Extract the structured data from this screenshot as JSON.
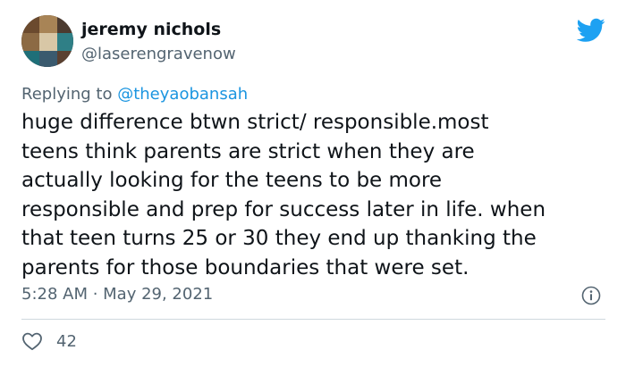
{
  "author": {
    "display_name": "jeremy nichols",
    "handle": "@laserengravenow"
  },
  "reply": {
    "prefix": "Replying to",
    "mention": "@theyaobansah"
  },
  "body_lines": [
    "huge difference btwn strict/ responsible.most",
    "teens think parents are strict when they are",
    "actually looking for the teens to be more",
    "responsible and prep for success later in life. when",
    "that teen turns 25 or 30 they end up thanking the",
    "parents for those boundaries that were set."
  ],
  "timestamp": "5:28 AM · May 29, 2021",
  "likes": "42",
  "icons": {
    "brand": "twitter-bird-icon",
    "info": "info-icon",
    "like": "heart-icon"
  },
  "colors": {
    "brand_blue": "#1da1f2",
    "mention_blue": "#1b95e0",
    "secondary_text": "#536471",
    "divider": "#cfd9de"
  }
}
